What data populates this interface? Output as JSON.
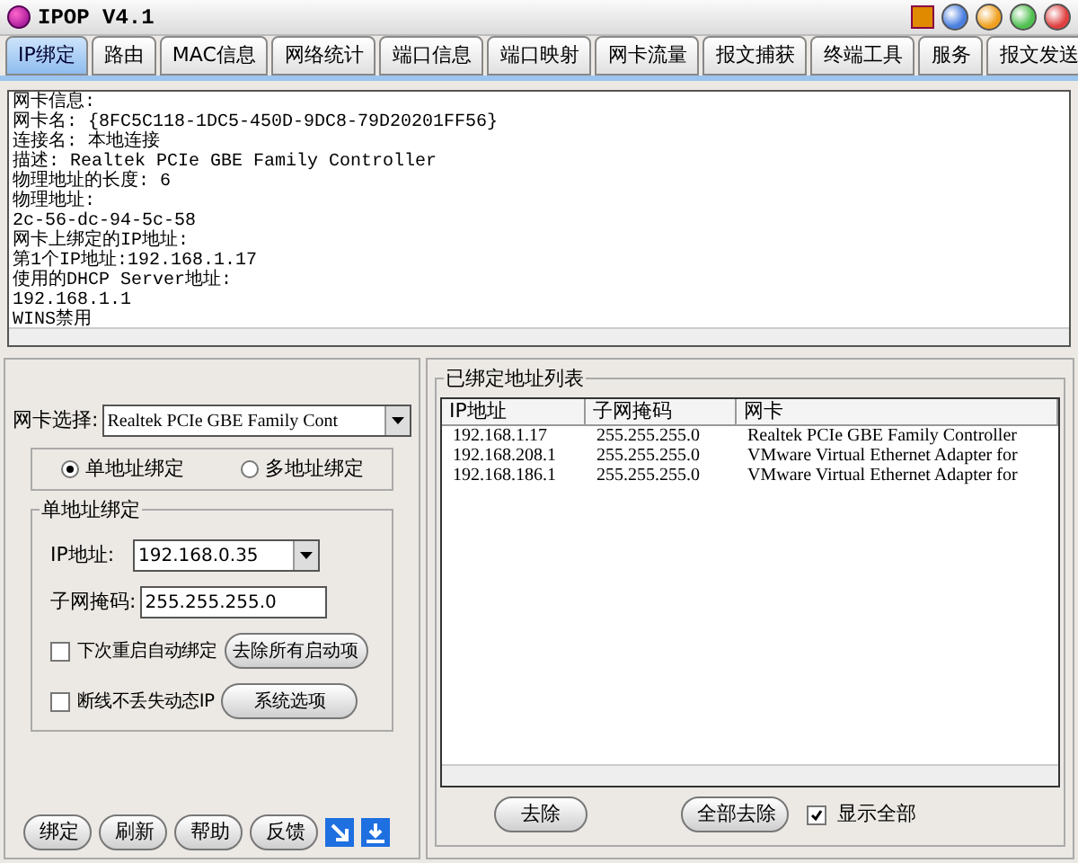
{
  "window": {
    "title": "IPOP V4.1"
  },
  "tabs": [
    {
      "label": "IP绑定",
      "selected": true
    },
    {
      "label": "路由",
      "selected": false
    },
    {
      "label": "MAC信息",
      "selected": false
    },
    {
      "label": "网络统计",
      "selected": false
    },
    {
      "label": "端口信息",
      "selected": false
    },
    {
      "label": "端口映射",
      "selected": false
    },
    {
      "label": "网卡流量",
      "selected": false
    },
    {
      "label": "报文捕获",
      "selected": false
    },
    {
      "label": "终端工具",
      "selected": false
    },
    {
      "label": "服务",
      "selected": false
    },
    {
      "label": "报文发送",
      "selected": false
    }
  ],
  "info_lines": [
    "网卡信息:",
    "网卡名: {8FC5C118-1DC5-450D-9DC8-79D20201FF56}",
    "连接名: 本地连接",
    "描述: Realtek PCIe GBE Family Controller",
    "物理地址的长度: 6",
    "物理地址:",
    "2c-56-dc-94-5c-58",
    "网卡上绑定的IP地址:",
    "第1个IP地址:192.168.1.17",
    "使用的DHCP Server地址:",
    "192.168.1.1",
    "WINS禁用"
  ],
  "adapter": {
    "label": "网卡选择:",
    "value": "Realtek PCIe GBE Family Cont"
  },
  "modes": [
    {
      "label": "单地址绑定",
      "selected": true
    },
    {
      "label": "多地址绑定",
      "selected": false
    }
  ],
  "single_group": {
    "title": "单地址绑定",
    "ip_label": "IP地址:",
    "ip_value": "192.168.0.35",
    "mask_label": "子网掩码:",
    "mask_value": "255.255.255.0",
    "options": [
      {
        "label": "下次重启自动绑定",
        "checked": false,
        "button": "去除所有启动项"
      },
      {
        "label": "断线不丢失动态IP",
        "checked": false,
        "button": "系统选项"
      }
    ]
  },
  "bottom_buttons": [
    "绑定",
    "刷新",
    "帮助",
    "反馈"
  ],
  "bound_list": {
    "title": "已绑定地址列表",
    "columns": [
      "IP地址",
      "子网掩码",
      "网卡"
    ],
    "rows": [
      [
        "192.168.1.17",
        "255.255.255.0",
        "Realtek PCIe GBE Family Controller"
      ],
      [
        "192.168.208.1",
        "255.255.255.0",
        "VMware Virtual Ethernet Adapter for"
      ],
      [
        "192.168.186.1",
        "255.255.255.0",
        "VMware Virtual Ethernet Adapter for"
      ]
    ],
    "buttons": [
      "去除",
      "全部去除"
    ],
    "show_all": {
      "label": "显示全部",
      "checked": true
    }
  }
}
